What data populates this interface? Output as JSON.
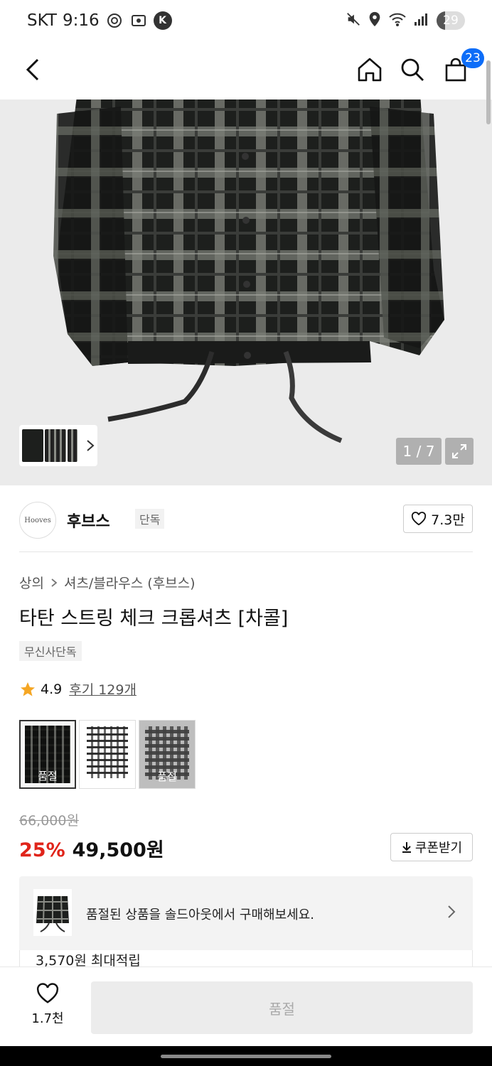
{
  "status_bar": {
    "carrier": "SKT",
    "time": "9:16",
    "battery": "29",
    "k_app": "K"
  },
  "nav": {
    "cart_count": "23"
  },
  "gallery": {
    "counter": "1 / 7"
  },
  "brand": {
    "logo_text": "Hooves",
    "name": "후브스",
    "tag": "단독",
    "likes": "7.3만"
  },
  "product": {
    "breadcrumb": [
      "상의",
      "셔츠/블라우스 (후브스)"
    ],
    "title": "타탄 스트링 체크 크롭셔츠 [차콜]",
    "exclusive_tag": "무신사단독",
    "rating": "4.9",
    "reviews": "후기 129개",
    "colors": [
      {
        "label": "품절",
        "selected": true
      },
      {
        "label": "",
        "selected": false
      },
      {
        "label": "품절",
        "selected": false
      }
    ],
    "original_price": "66,000원",
    "discount": "25%",
    "price": "49,500원",
    "coupon_label": "쿠폰받기"
  },
  "soldout_banner": {
    "text": "품절된 상품을 솔드아웃에서 구매해보세요."
  },
  "points": {
    "text": "3,570원 최대적립"
  },
  "bottom": {
    "wish_count": "1.7천",
    "buy_label": "품절"
  },
  "colors": {
    "accent_badge": "#0d6df8",
    "discount_red": "#e0241a"
  }
}
